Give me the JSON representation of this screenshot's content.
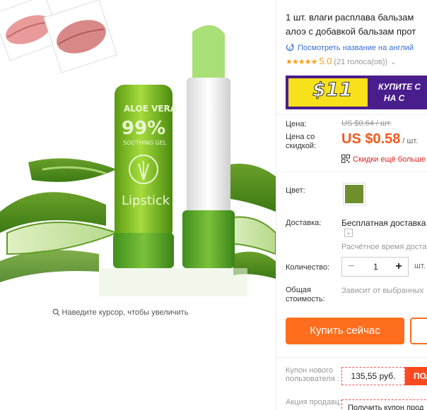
{
  "product": {
    "title_line1": "1 шт. влаги расплава бальзам",
    "title_line2": "алоэ с добавкой бальзам прот",
    "translate_link": "Посмотреть название на англий",
    "rating_score": "5.0",
    "rating_votes": "(21 голоса(ов))",
    "banner": {
      "amount": "$11",
      "text_line1": "КУПИТЕ С",
      "text_line2": "НА С",
      "accent_color": "#4a1d8c",
      "highlight_color": "#f7e11b"
    },
    "price_label": "Цена:",
    "old_price": "US $0.64 / шт.",
    "discount_label": "Цена со скидкой:",
    "price": "US $0.58",
    "price_unit": "/ шт.",
    "more_discounts": "Скидки ещё больше",
    "color_label": "Цвет:",
    "color_swatch": "#6f8f2c",
    "shipping_label": "Доставка:",
    "shipping_method": "Бесплатная доставка",
    "shipping_time": "Расчётное время доста",
    "quantity_label": "Количество:",
    "quantity": "1",
    "quantity_unit": "шт.",
    "total_label": "Общая стоимость:",
    "total_value": "Зависит от выбранных",
    "buy_now": "Купить сейчас",
    "coupon_label": "Купон нового пользователя :",
    "coupon_value": "135,55 руб.",
    "coupon_get": "ПОЛ",
    "promo_label": "Акция продавц:",
    "promo_value": "Получить купон прод"
  },
  "image": {
    "zoom_hint": "Наведите курсор, чтобы увеличить",
    "tube_text_brand": "ALOE VERA",
    "tube_text_percent": "99%",
    "tube_text_sub": "SOOTHING GEL",
    "tube_text_name": "Lipstick"
  },
  "colors": {
    "accent": "#ff6e1f",
    "price": "#f25a1b",
    "star": "#f6a01a",
    "link": "#3a6fd8"
  }
}
